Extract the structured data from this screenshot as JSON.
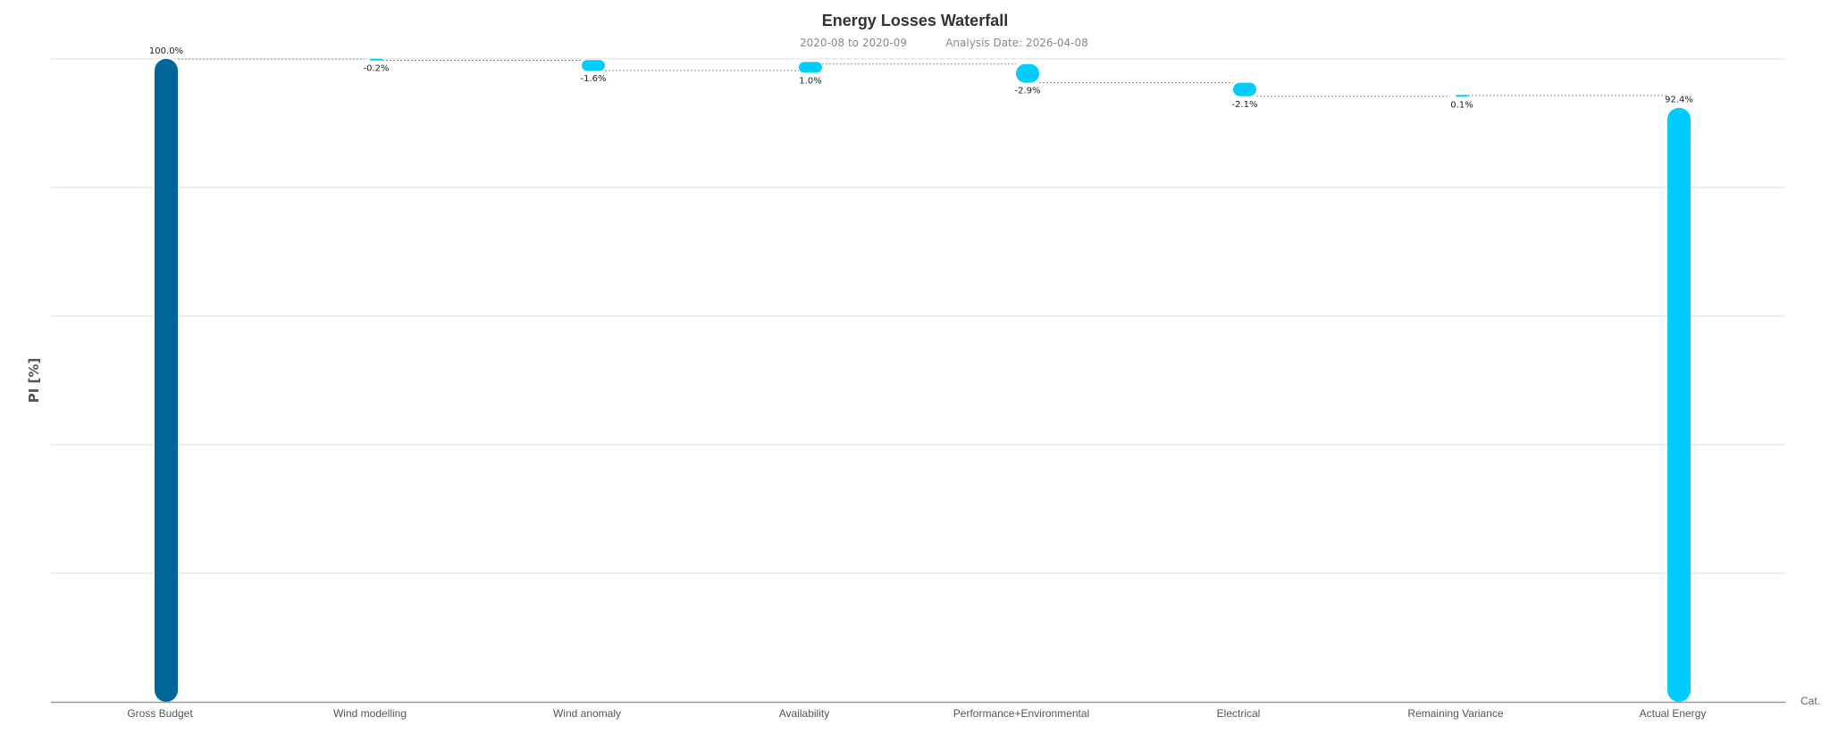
{
  "chart_data": {
    "type": "bar",
    "subtype": "waterfall",
    "title": "Energy Losses Waterfall",
    "subtitle_period": "2020-08 to 2020-09",
    "subtitle_date": "Analysis Date: 2026-04-08",
    "ylabel": "PI [%]",
    "xlabel": "Cat.",
    "ylim": [
      0,
      100
    ],
    "grid": true,
    "categories": [
      "Gross Budget",
      "Wind modelling",
      "Wind anomaly",
      "Availability",
      "Performance+Environmental",
      "Electrical",
      "Remaining Variance",
      "Actual Energy"
    ],
    "values": [
      100.0,
      -0.2,
      -1.6,
      1.0,
      -2.9,
      -2.1,
      0.1,
      92.4
    ],
    "labels": [
      "100.0%",
      "-0.2%",
      "-1.6%",
      "1.0%",
      "-2.9%",
      "-2.1%",
      "0.1%",
      "92.4%"
    ],
    "kinds": [
      "total",
      "delta",
      "delta",
      "delta",
      "delta",
      "delta",
      "delta",
      "total"
    ],
    "colors": {
      "gross": "#006699",
      "delta": "#00ccff",
      "actual": "#00ccff",
      "grid": "#dddddd",
      "axis": "#999999",
      "connector": "#888888"
    }
  }
}
